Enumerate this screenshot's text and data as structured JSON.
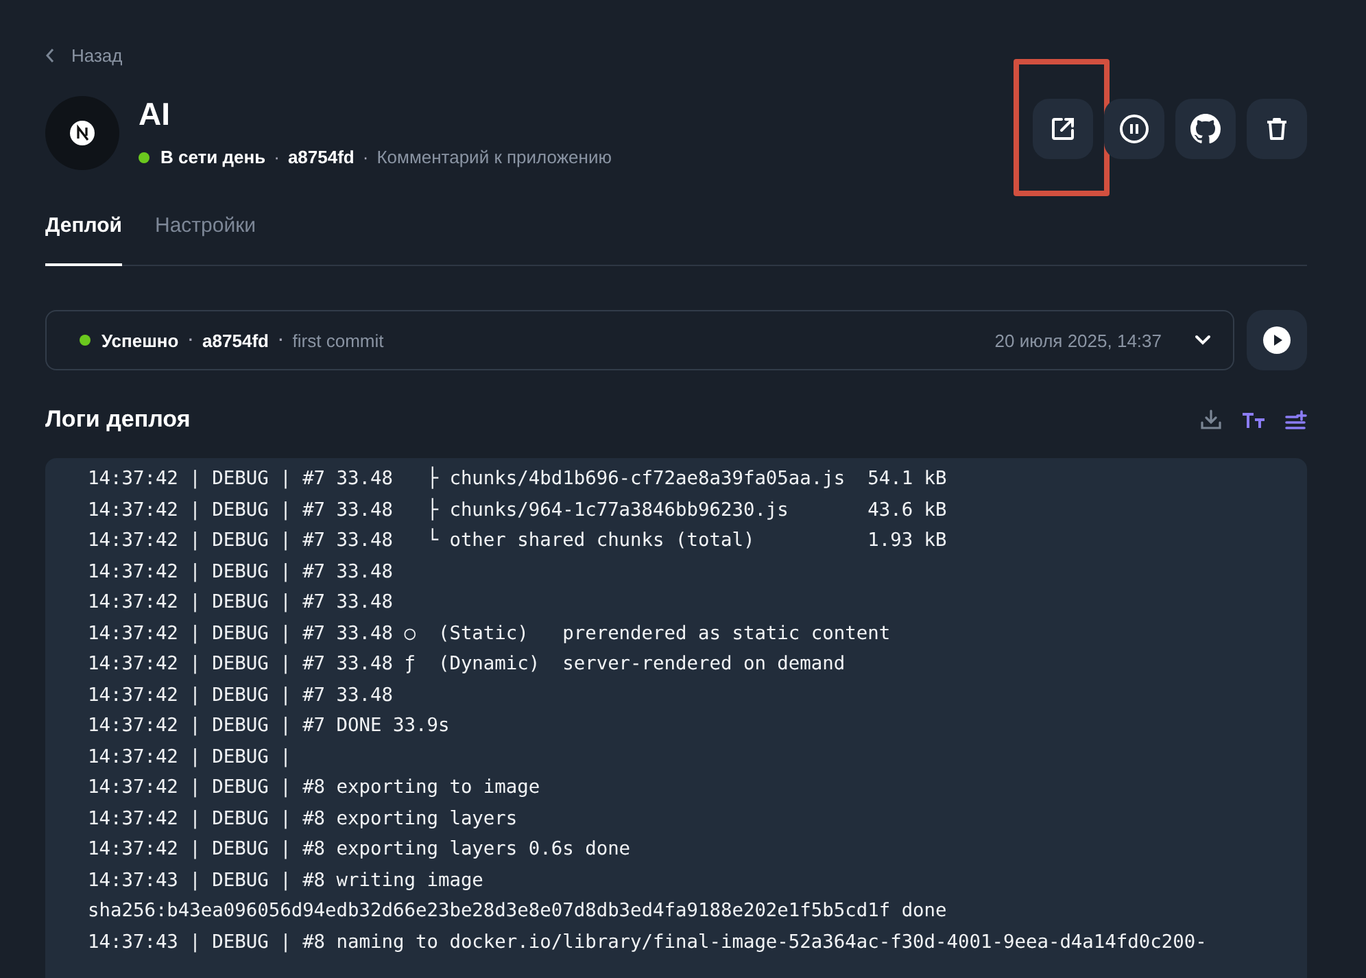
{
  "back_link": {
    "label": "Назад"
  },
  "app": {
    "name": "AI",
    "status": {
      "label": "В сети день",
      "color": "#6bc81e"
    },
    "commit": "a8754fd",
    "comment_link": "Комментарий к приложению"
  },
  "actions": [
    {
      "kind": "open",
      "highlighted": true
    },
    {
      "kind": "pause",
      "highlighted": false
    },
    {
      "kind": "github",
      "highlighted": false
    },
    {
      "kind": "delete",
      "highlighted": false
    }
  ],
  "tabs": [
    {
      "label": "Деплой",
      "selected": true
    },
    {
      "label": "Настройки",
      "selected": false
    }
  ],
  "separator": "·",
  "deployment": {
    "status": {
      "label": "Успешно",
      "color": "#6bc81e"
    },
    "commit": "a8754fd",
    "message": "first commit",
    "date": "20 июля 2025, 14:37",
    "expanded": false
  },
  "logs": {
    "title": "Логи деплоя",
    "lines": [
      "14:37:42 | DEBUG | #7 33.48   ├ chunks/4bd1b696-cf72ae8a39fa05aa.js  54.1 kB",
      "14:37:42 | DEBUG | #7 33.48   ├ chunks/964-1c77a3846bb96230.js       43.6 kB",
      "14:37:42 | DEBUG | #7 33.48   └ other shared chunks (total)          1.93 kB",
      "14:37:42 | DEBUG | #7 33.48",
      "14:37:42 | DEBUG | #7 33.48",
      "14:37:42 | DEBUG | #7 33.48 ○  (Static)   prerendered as static content",
      "14:37:42 | DEBUG | #7 33.48 ƒ  (Dynamic)  server-rendered on demand",
      "14:37:42 | DEBUG | #7 33.48",
      "14:37:42 | DEBUG | #7 DONE 33.9s",
      "14:37:42 | DEBUG |",
      "14:37:42 | DEBUG | #8 exporting to image",
      "14:37:42 | DEBUG | #8 exporting layers",
      "14:37:42 | DEBUG | #8 exporting layers 0.6s done",
      "14:37:43 | DEBUG | #8 writing image",
      "sha256:b43ea096056d94edb32d66e23be28d3e8e07d8db3ed4fa9188e202e1f5b5cd1f done",
      "14:37:43 | DEBUG | #8 naming to docker.io/library/final-image-52a364ac-f30d-4001-9eea-d4a14fd0c200-"
    ]
  }
}
